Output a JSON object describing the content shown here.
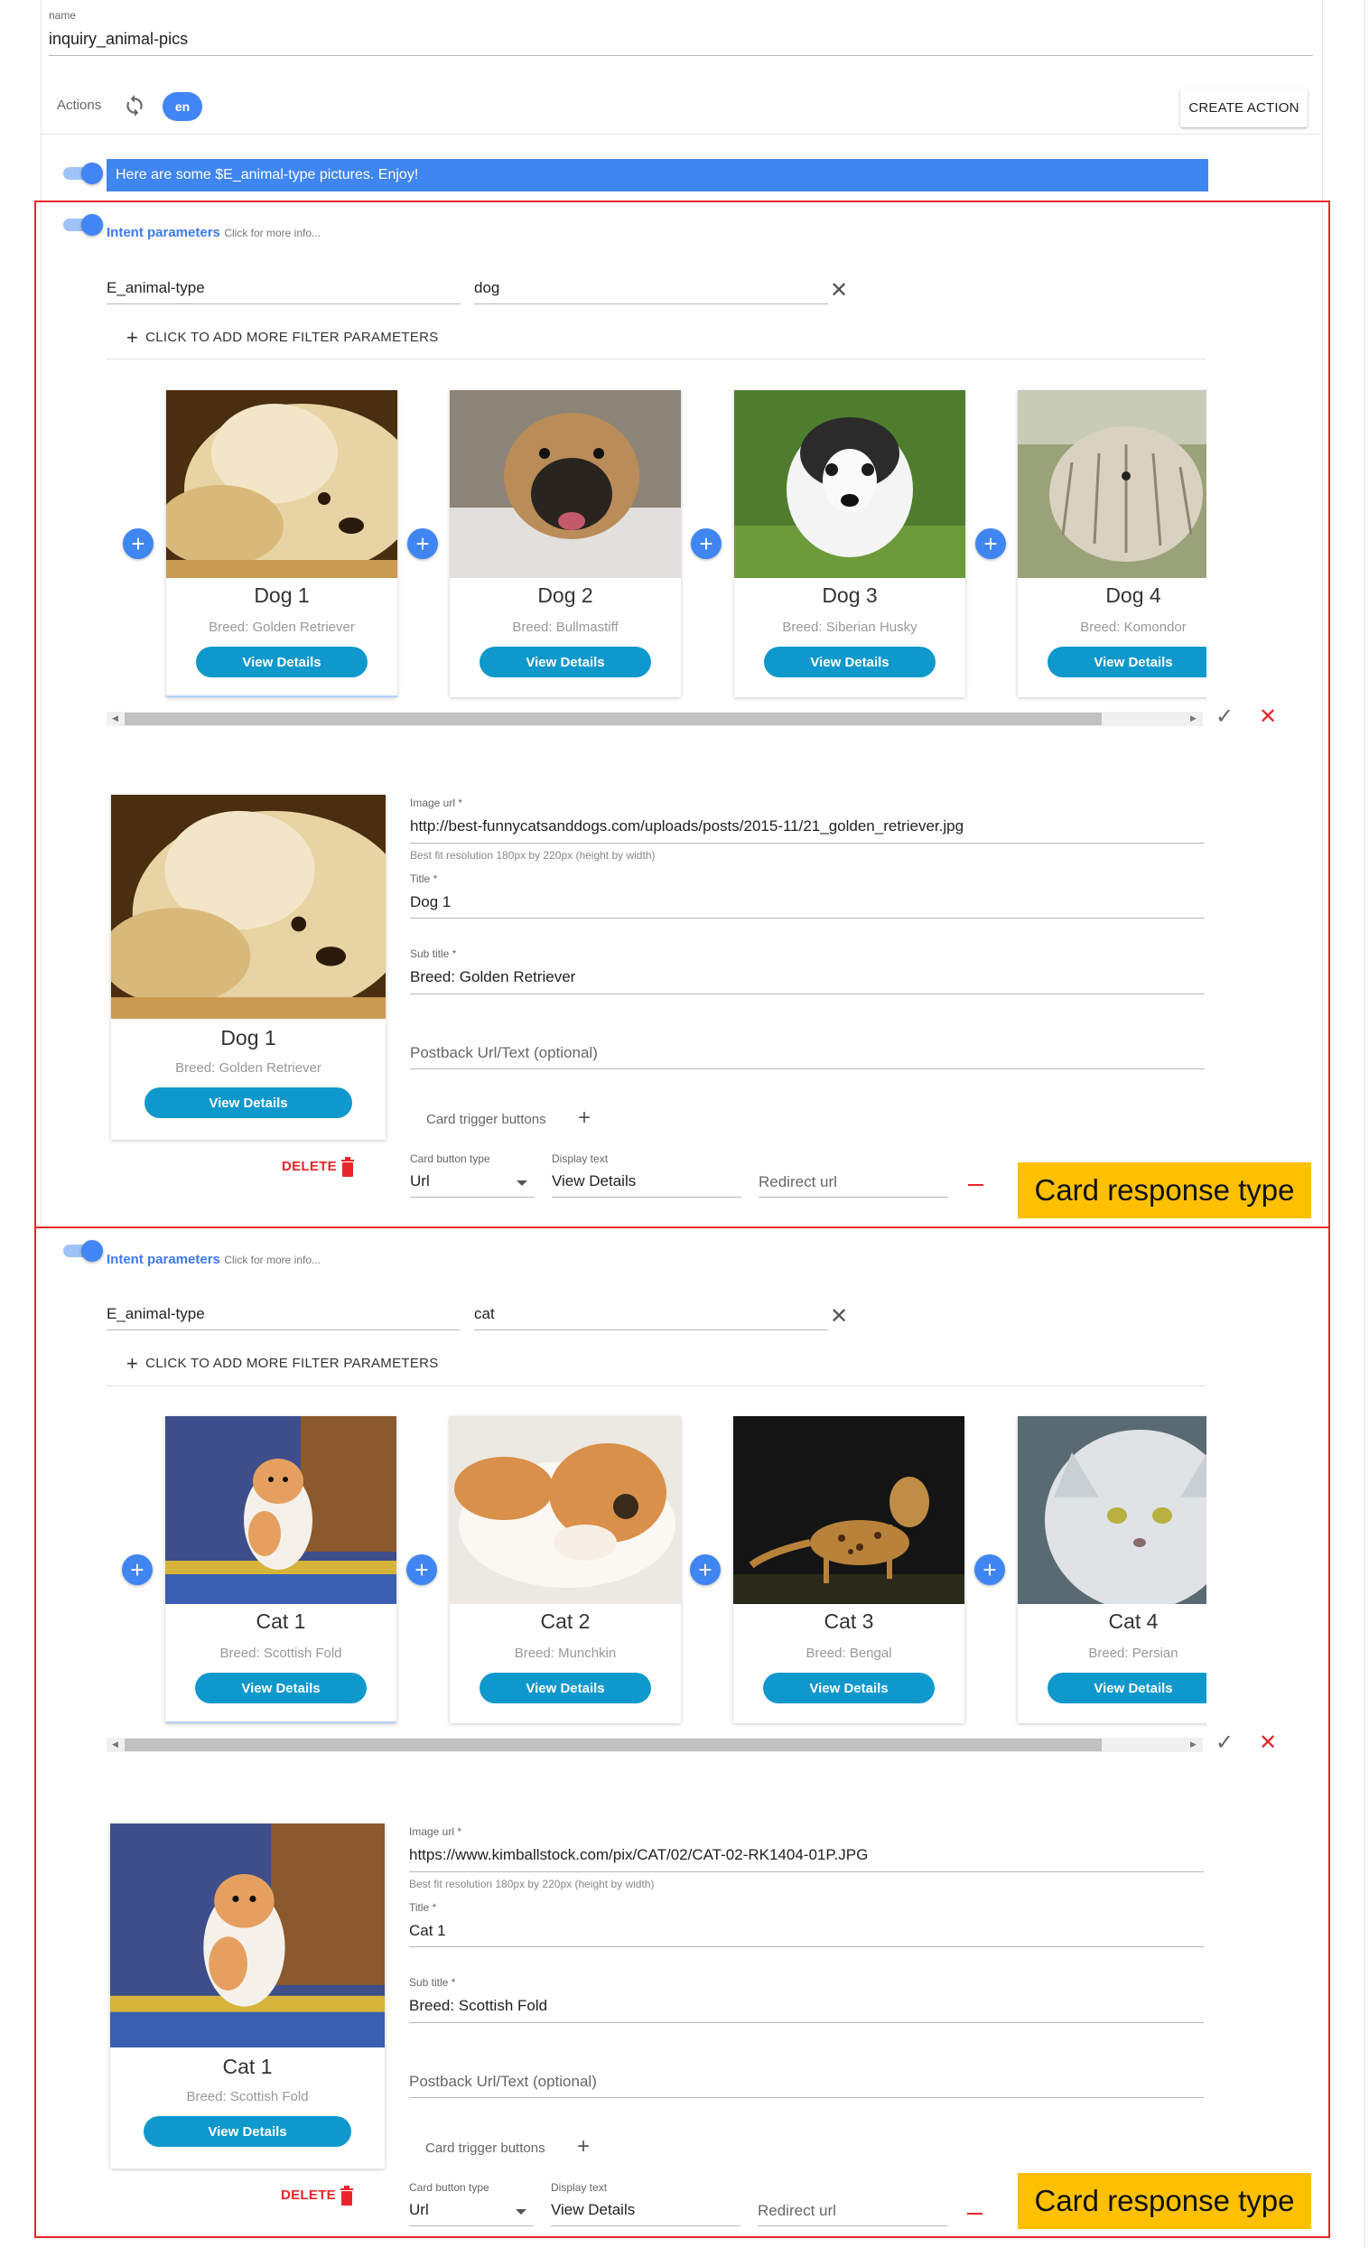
{
  "intent": {
    "name_label": "name",
    "name_value": "inquiry_animal-pics",
    "actions_label": "Actions",
    "lang": "en",
    "create_action": "CREATE ACTION",
    "text_response": "Here are some $E_animal-type pictures. Enjoy!"
  },
  "colors": {
    "accent_blue": "#3f86f2",
    "view_button": "#0f98cc",
    "annotation_red": "#e8262a",
    "annotation_yellow": "#ffc000"
  },
  "sections": [
    {
      "intent_params_label": "Intent parameters",
      "click_info": "Click for more info...",
      "filter_key": "E_animal-type",
      "filter_value": "dog",
      "add_filter": "CLICK TO ADD MORE FILTER PARAMETERS",
      "cards": [
        {
          "title": "Dog 1",
          "sub": "Breed: Golden Retriever",
          "button": "View Details",
          "img": "golden"
        },
        {
          "title": "Dog 2",
          "sub": "Breed: Bullmastiff",
          "button": "View Details",
          "img": "bullmastiff"
        },
        {
          "title": "Dog 3",
          "sub": "Breed: Siberian Husky",
          "button": "View Details",
          "img": "husky"
        },
        {
          "title": "Dog 4",
          "sub": "Breed: Komondor",
          "button": "View Details",
          "img": "komondor"
        }
      ],
      "editor": {
        "card_title": "Dog 1",
        "card_sub": "Breed: Golden Retriever",
        "card_button": "View Details",
        "image_url_label": "Image url",
        "image_url": "http://best-funnycatsanddogs.com/uploads/posts/2015-11/21_golden_retriever.jpg",
        "resolution_hint": "Best fit resolution 180px by 220px (height by width)",
        "title_label": "Title",
        "title_value": "Dog 1",
        "subtitle_label": "Sub title",
        "subtitle_value": "Breed: Golden Retriever",
        "postback_label": "Postback Url/Text (optional)",
        "trigger_label": "Card trigger buttons",
        "button_type_label": "Card button type",
        "button_type_value": "Url",
        "display_text_label": "Display text",
        "display_text_value": "View Details",
        "redirect_label": "Redirect url",
        "delete_label": "DELETE"
      },
      "annotation": "Card response type"
    },
    {
      "intent_params_label": "Intent parameters",
      "click_info": "Click for more info...",
      "filter_key": "E_animal-type",
      "filter_value": "cat",
      "add_filter": "CLICK TO ADD MORE FILTER PARAMETERS",
      "cards": [
        {
          "title": "Cat 1",
          "sub": "Breed: Scottish Fold",
          "button": "View Details",
          "img": "scottish"
        },
        {
          "title": "Cat 2",
          "sub": "Breed: Munchkin",
          "button": "View Details",
          "img": "munchkin"
        },
        {
          "title": "Cat 3",
          "sub": "Breed: Bengal",
          "button": "View Details",
          "img": "bengal"
        },
        {
          "title": "Cat 4",
          "sub": "Breed: Persian",
          "button": "View Details",
          "img": "persian"
        }
      ],
      "editor": {
        "card_title": "Cat 1",
        "card_sub": "Breed: Scottish Fold",
        "card_button": "View Details",
        "image_url_label": "Image url",
        "image_url": "https://www.kimballstock.com/pix/CAT/02/CAT-02-RK1404-01P.JPG",
        "resolution_hint": "Best fit resolution 180px by 220px (height by width)",
        "title_label": "Title",
        "title_value": "Cat 1",
        "subtitle_label": "Sub title",
        "subtitle_value": "Breed: Scottish Fold",
        "postback_label": "Postback Url/Text (optional)",
        "trigger_label": "Card trigger buttons",
        "button_type_label": "Card button type",
        "button_type_value": "Url",
        "display_text_label": "Display text",
        "display_text_value": "View Details",
        "redirect_label": "Redirect url",
        "delete_label": "DELETE"
      },
      "annotation": "Card response type"
    }
  ]
}
